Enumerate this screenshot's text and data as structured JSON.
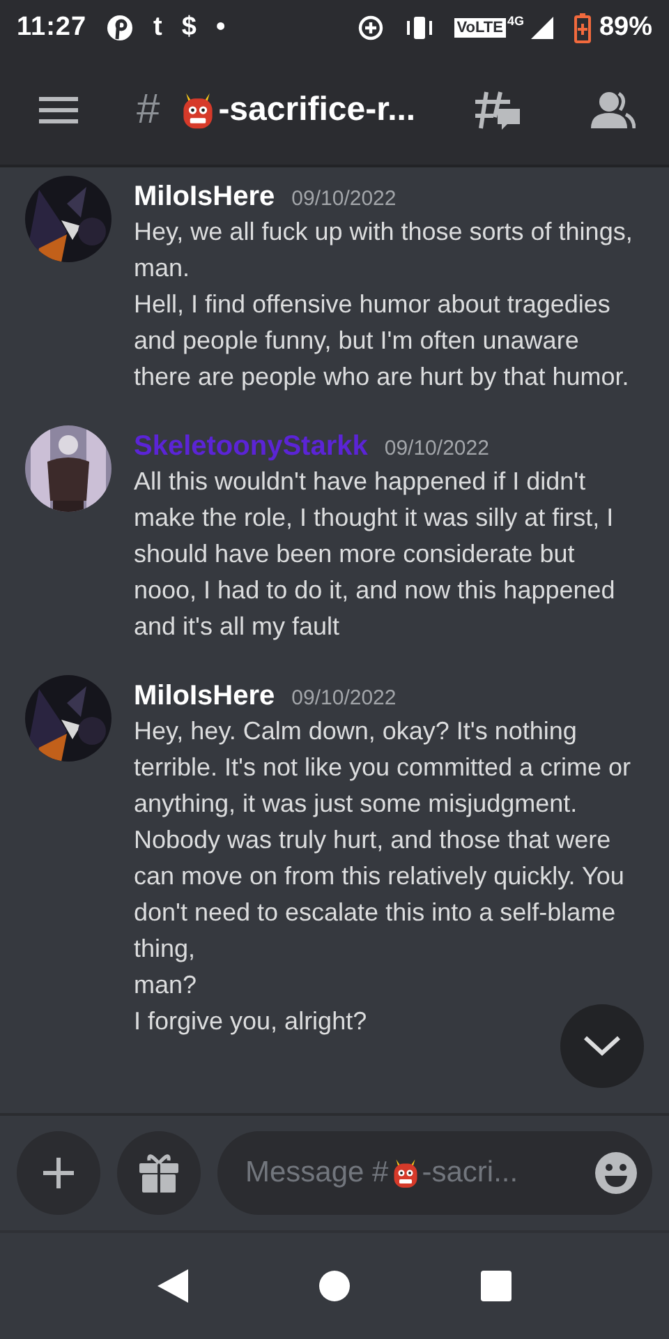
{
  "status_bar": {
    "time": "11:27",
    "notification_glyphs": [
      "t",
      "$",
      "•"
    ],
    "network_label": "VoLTE",
    "network_type": "4G",
    "battery": "89%"
  },
  "header": {
    "hash": "#",
    "channel": "-sacrifice-r..."
  },
  "messages": [
    {
      "author": "MiloIsHere",
      "color": "#ffffff",
      "timestamp": "09/10/2022",
      "paragraphs": [
        "Hey, we all fuck up with those sorts of things, man.",
        "Hell, I find offensive humor about tragedies and people funny, but I'm often unaware there are people who are hurt by that humor."
      ]
    },
    {
      "author": "SkeletoonyStarkk",
      "color": "#5b24d6",
      "timestamp": "09/10/2022",
      "paragraphs": [
        "All this wouldn't have happened if I didn't make the role, I thought it was silly at first, I should have been more considerate but nooo, I had to do it, and now this happened and it's all my fault"
      ]
    },
    {
      "author": "MiloIsHere",
      "color": "#ffffff",
      "timestamp": "09/10/2022",
      "paragraphs": [
        "Hey, hey. Calm down, okay? It's nothing terrible. It's not like you committed a crime or anything, it was just some misjudgment. Nobody was truly hurt, and those that were can move on from this relatively quickly. You don't need to escalate this into a self-blame thing,",
        "man?",
        "I forgive you, alright?"
      ]
    }
  ],
  "composer": {
    "placeholder": "Message #",
    "channel_suffix": "-sacri..."
  }
}
